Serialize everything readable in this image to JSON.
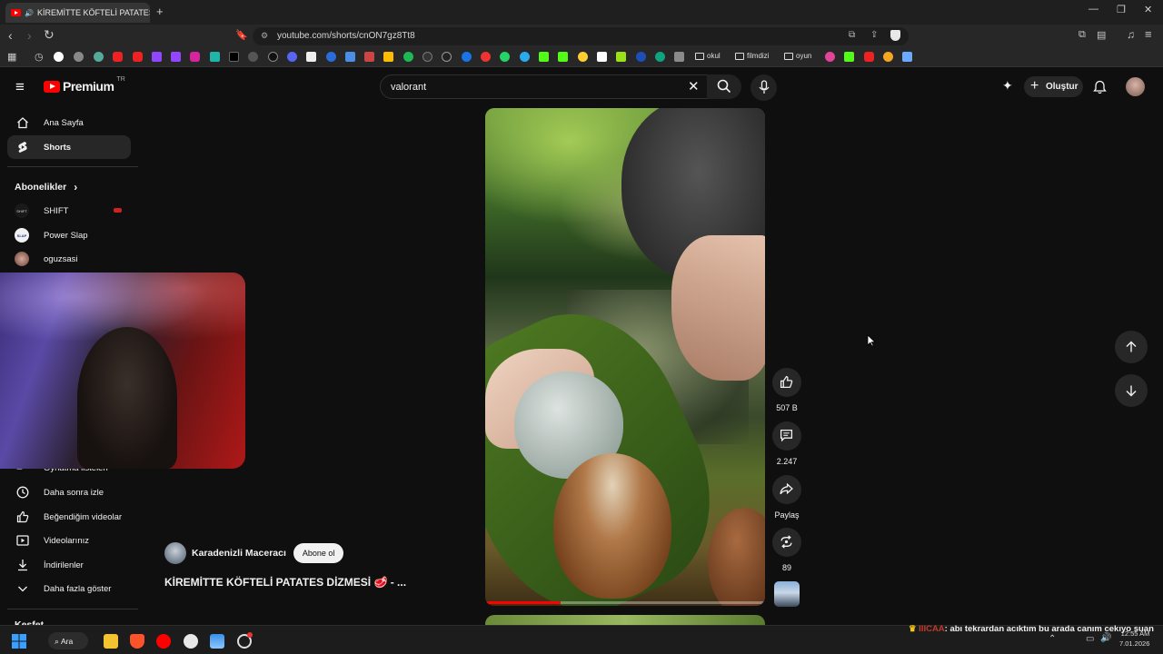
{
  "browser": {
    "tab_title": "KİREMİTTE KÖFTELİ PATATES",
    "url": "youtube.com/shorts/cnON7gz8Tt8",
    "bookmark_folders": [
      "okul",
      "filmdizi",
      "oyun"
    ]
  },
  "header": {
    "logo_text": "Premium",
    "logo_badge": "TR",
    "search_value": "valorant",
    "create_label": "Oluştur"
  },
  "sidebar": {
    "main_items": [
      {
        "label": "Ana Sayfa",
        "icon": "home-icon"
      },
      {
        "label": "Shorts",
        "icon": "shorts-icon"
      }
    ],
    "subscriptions_heading": "Abonelikler",
    "subscriptions": [
      {
        "label": "SHIFT",
        "avatar_text": "SHIFT"
      },
      {
        "label": "Power Slap",
        "avatar_text": "SLAP"
      },
      {
        "label": "oguzsasi",
        "avatar_text": ""
      }
    ],
    "partial_item": "Oynatma listeleri",
    "you_items": [
      {
        "label": "Daha sonra izle",
        "icon": "clock-icon"
      },
      {
        "label": "Beğendiğim videolar",
        "icon": "thumbs-up-icon"
      },
      {
        "label": "Videolarınız",
        "icon": "video-icon"
      },
      {
        "label": "İndirilenler",
        "icon": "download-icon"
      },
      {
        "label": "Daha fazla göster",
        "icon": "chevron-down-icon"
      }
    ],
    "bottom_heading": "Keşfet"
  },
  "short": {
    "channel": "Karadenizli Maceracı",
    "subscribe_label": "Abone ol",
    "title": "KİREMİTTE KÖFTELİ PATATES DİZMESİ 🥩 - ...",
    "progress": 0.27
  },
  "actions": {
    "likes": "507 B",
    "comments": "2.247",
    "share": "Paylaş",
    "remix": "89"
  },
  "taskbar": {
    "search_label": "Ara",
    "chat_user": "IIICAA",
    "chat_message": ": abı tekrardan acıktım bu arada canım cekıyo suan",
    "time": "12:55 AM",
    "date": "7.01.2026"
  }
}
